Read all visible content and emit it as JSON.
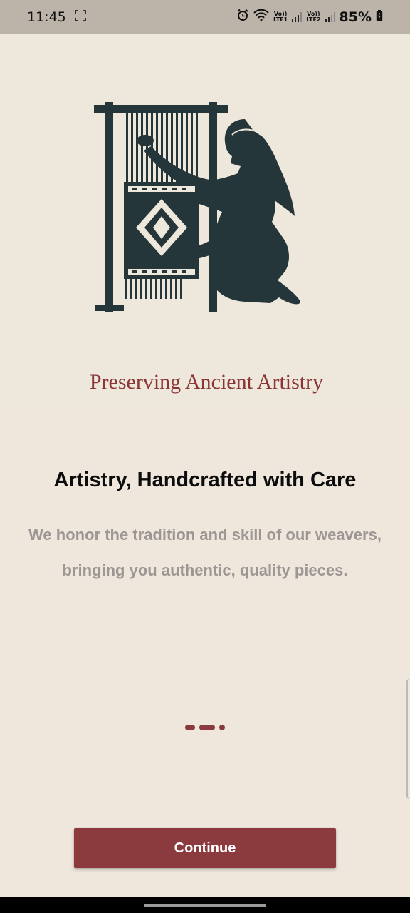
{
  "status_bar": {
    "time": "11:45",
    "lte1": "LTE1",
    "lte2": "LTE2",
    "volte": "Vo))",
    "battery": "85%",
    "icons": [
      "screenshot-icon",
      "alarm-icon",
      "wifi-icon",
      "signal-icon",
      "battery-icon"
    ]
  },
  "hero": {
    "tagline": "Preserving Ancient Artistry",
    "illustration": "woman-weaving-at-loom"
  },
  "content": {
    "title": "Artistry, Handcrafted with Care",
    "description_line1": "We honor the tradition and skill of our weavers,",
    "description_line2": "bringing you authentic, quality pieces."
  },
  "pager": {
    "count": 3,
    "active_index": 1
  },
  "actions": {
    "continue_label": "Continue"
  },
  "colors": {
    "accent": "#8b3a3e",
    "background": "#efe6dc",
    "illustration": "#24363a",
    "tagline": "#8b3535"
  }
}
